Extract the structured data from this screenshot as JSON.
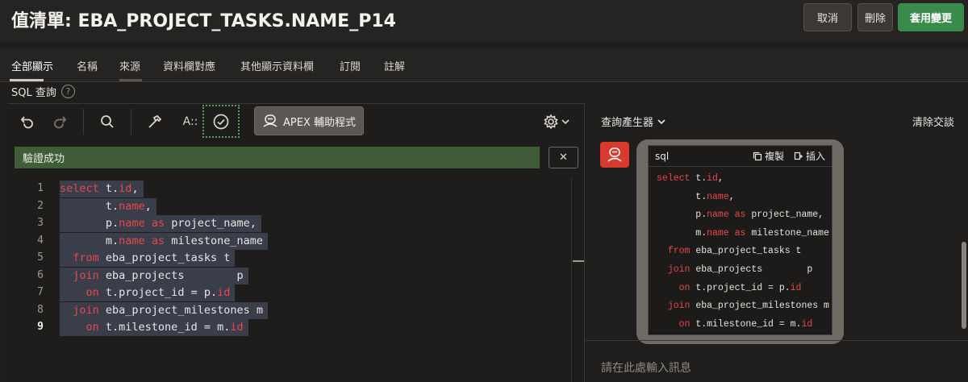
{
  "header": {
    "title": "值清單: EBA_PROJECT_TASKS.NAME_P14",
    "cancel_label": "取消",
    "delete_label": "刪除",
    "apply_label": "套用變更"
  },
  "tabs": [
    {
      "label": "全部顯示",
      "active": true
    },
    {
      "label": "名稱"
    },
    {
      "label": "來源"
    },
    {
      "label": "資料欄對應"
    },
    {
      "label": "其他顯示資料欄"
    },
    {
      "label": "訂閱"
    },
    {
      "label": "註解"
    }
  ],
  "section": {
    "label": "SQL 查詢",
    "help": "?"
  },
  "toolbar": {
    "undo_icon": "undo-icon",
    "redo_icon": "redo-icon",
    "search_icon": "search-icon",
    "format_icon": "hammer-icon",
    "autocomplete_label": "A::",
    "validate_icon": "check-circle-icon",
    "apex_label": "APEX 輔助程式",
    "settings_icon": "gear-icon"
  },
  "validation": {
    "message": "驗證成功",
    "close_symbol": "✕"
  },
  "code": {
    "line_numbers": [
      "1",
      "2",
      "3",
      "4",
      "5",
      "6",
      "7",
      "8",
      "9"
    ],
    "lines": [
      [
        {
          "t": "select",
          "k": 1
        },
        {
          "t": " t."
        },
        {
          "t": "id",
          "k": 1
        },
        {
          "t": ","
        }
      ],
      [
        {
          "t": "       t."
        },
        {
          "t": "name",
          "k": 1
        },
        {
          "t": ","
        }
      ],
      [
        {
          "t": "       p."
        },
        {
          "t": "name",
          "k": 1
        },
        {
          "t": " "
        },
        {
          "t": "as",
          "k": 1
        },
        {
          "t": " project_name,"
        }
      ],
      [
        {
          "t": "       m."
        },
        {
          "t": "name",
          "k": 1
        },
        {
          "t": " "
        },
        {
          "t": "as",
          "k": 1
        },
        {
          "t": " milestone_name"
        }
      ],
      [
        {
          "t": "  "
        },
        {
          "t": "from",
          "k": 1
        },
        {
          "t": " eba_project_tasks t"
        }
      ],
      [
        {
          "t": "  "
        },
        {
          "t": "join",
          "k": 1
        },
        {
          "t": " eba_projects        p"
        }
      ],
      [
        {
          "t": "    "
        },
        {
          "t": "on",
          "k": 1
        },
        {
          "t": " t.project_id = p."
        },
        {
          "t": "id",
          "k": 1
        }
      ],
      [
        {
          "t": "  "
        },
        {
          "t": "join",
          "k": 1
        },
        {
          "t": " eba_project_milestones m"
        }
      ],
      [
        {
          "t": "    "
        },
        {
          "t": "on",
          "k": 1
        },
        {
          "t": " t.milestone_id = m."
        },
        {
          "t": "id",
          "k": 1
        }
      ]
    ]
  },
  "assistant": {
    "query_builder_label": "查詢產生器",
    "clear_chat_label": "清除交談",
    "snippet_lang": "sql",
    "copy_label": "複製",
    "insert_label": "插入",
    "input_placeholder": "請在此處輸入訊息"
  },
  "colors": {
    "keyword": "#e8484a",
    "apply_button": "#3a8a4a",
    "success_bar": "#3f5e38",
    "selection": "#3a3d4a",
    "assistant_avatar": "#d83a2e"
  }
}
